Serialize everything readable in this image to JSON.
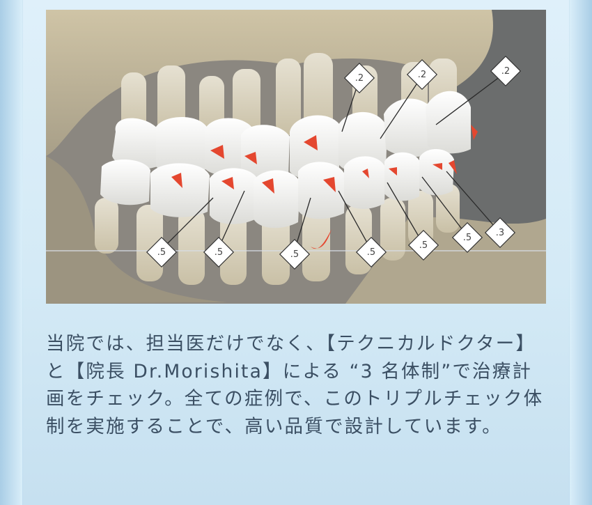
{
  "visual": {
    "measurements": [
      ".2",
      ".2",
      ".2",
      ".5",
      ".5",
      ".5",
      ".5",
      ".5",
      ".5",
      ".3"
    ]
  },
  "caption": "当院では、担当医だけでなく、【テクニカルドクター】と【院長 Dr.Morishita】による “3 名体制”で治療計画をチェック。全ての症例で、このトリプルチェック体制を実施することで、高い品質で設計しています。"
}
